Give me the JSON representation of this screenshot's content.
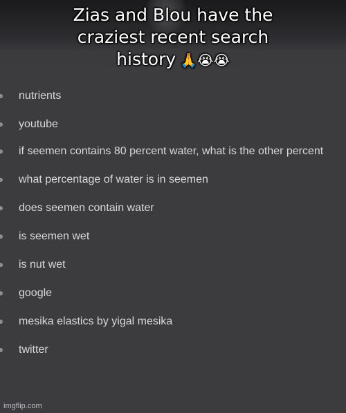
{
  "caption": {
    "line1": "Zias and Blou have the",
    "line2": "craziest recent search",
    "line3": "history",
    "emojis": "🙏😭😭"
  },
  "search_history": {
    "items": [
      {
        "text": "nutrients"
      },
      {
        "text": "youtube"
      },
      {
        "text": "if seemen contains 80 percent water, what is the other percent"
      },
      {
        "text": "what percentage of water is in seemen"
      },
      {
        "text": "does seemen contain water"
      },
      {
        "text": "is seemen wet"
      },
      {
        "text": "is nut wet"
      },
      {
        "text": "google"
      },
      {
        "text": "mesika elastics by yigal mesika"
      },
      {
        "text": "twitter"
      }
    ]
  },
  "watermark": "imgflip.com",
  "colors": {
    "panel_bg": "#3c3c3f",
    "text": "#d9d9dc",
    "caption_text": "#ffffff"
  }
}
